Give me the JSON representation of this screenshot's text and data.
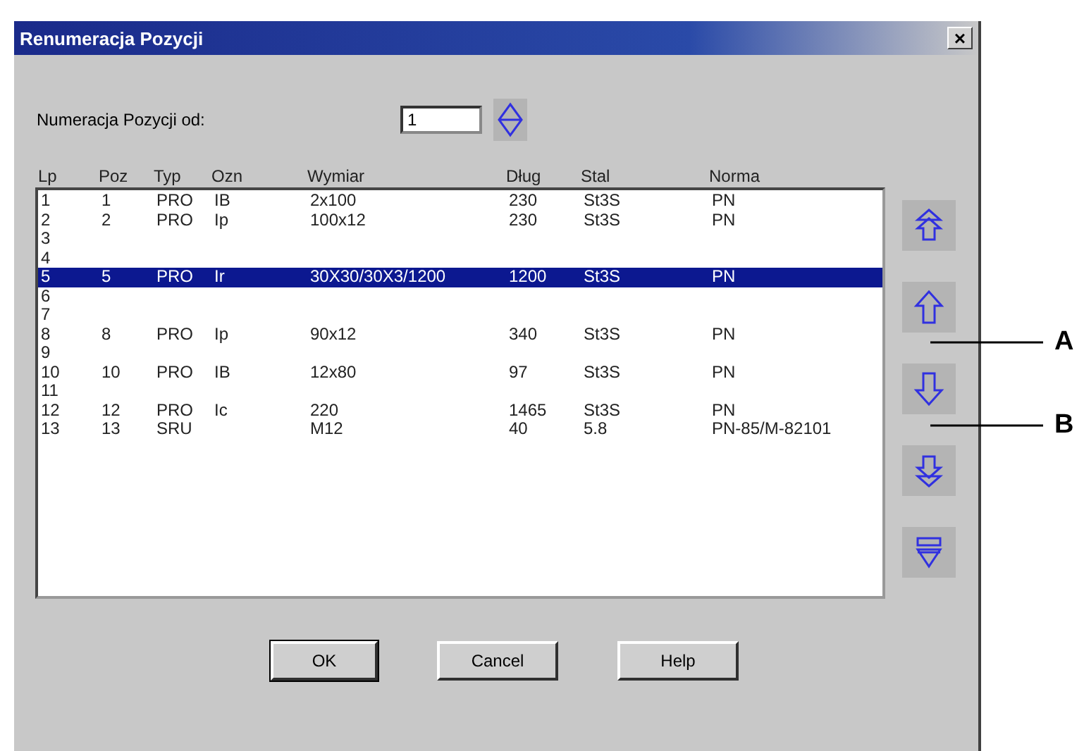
{
  "window": {
    "title": "Renumeracja Pozycji",
    "close": "×"
  },
  "start": {
    "label": "Numeracja Pozycji od:",
    "value": "1"
  },
  "table": {
    "columns": [
      "Lp",
      "Poz",
      "Typ",
      "Ozn",
      "Wymiar",
      "Dług",
      "Stal",
      "Norma"
    ],
    "rows": [
      {
        "cells": [
          "1",
          "1",
          "PRO",
          "IB",
          "2x100",
          "230",
          "St3S",
          "PN"
        ],
        "selected": false
      },
      {
        "cells": [
          "2",
          "2",
          "PRO",
          "Ip",
          "100x12",
          "230",
          "St3S",
          "PN"
        ],
        "selected": false
      },
      {
        "cells": [
          "3"
        ],
        "selected": false
      },
      {
        "cells": [
          "4"
        ],
        "selected": false
      },
      {
        "cells": [
          "5",
          "5",
          "PRO",
          "Ir",
          "30X30/30X3/1200",
          "1200",
          "St3S",
          "PN"
        ],
        "selected": true
      },
      {
        "cells": [
          "6"
        ],
        "selected": false
      },
      {
        "cells": [
          "7"
        ],
        "selected": false
      },
      {
        "cells": [
          "8",
          "8",
          "PRO",
          "Ip",
          "90x12",
          "340",
          "St3S",
          "PN"
        ],
        "selected": false
      },
      {
        "cells": [
          "9"
        ],
        "selected": false
      },
      {
        "cells": [
          "10",
          "10",
          "PRO",
          "IB",
          "12x80",
          "97",
          "St3S",
          "PN"
        ],
        "selected": false
      },
      {
        "cells": [
          "11"
        ],
        "selected": false
      },
      {
        "cells": [
          "12",
          "12",
          "PRO",
          "Ic",
          "220",
          "1465",
          "St3S",
          "PN"
        ],
        "selected": false
      },
      {
        "cells": [
          "13",
          "13",
          "SRU",
          "",
          "M12",
          "40",
          "5.8",
          "PN-85/M-82101"
        ],
        "selected": false
      }
    ]
  },
  "buttons": [
    "OK",
    "Cancel",
    "Help"
  ],
  "callouts": [
    {
      "label": "A"
    },
    {
      "label": "B"
    }
  ]
}
